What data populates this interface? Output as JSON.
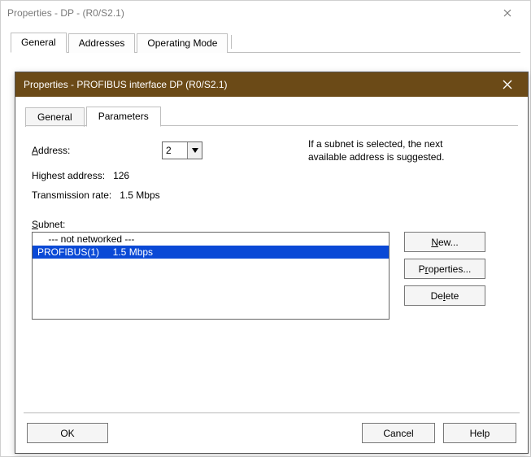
{
  "outer": {
    "title": "Properties - DP - (R0/S2.1)",
    "tabs": [
      "General",
      "Addresses",
      "Operating Mode"
    ]
  },
  "inner": {
    "title": "Properties - PROFIBUS interface  DP (R0/S2.1)",
    "tabs": [
      "General",
      "Parameters"
    ],
    "active_tab": "Parameters",
    "address_label": "Address:",
    "address_value": "2",
    "hint_line1": "If a subnet is selected, the next",
    "hint_line2": "available address is suggested.",
    "highest_label": "Highest address:",
    "highest_value": "126",
    "txrate_label": "Transmission rate:",
    "txrate_value": "1.5 Mbps",
    "subnet_label": "Subnet:",
    "subnet_items": [
      "    --- not networked ---",
      "PROFIBUS(1)     1.5 Mbps"
    ],
    "buttons": {
      "new": "New...",
      "properties": "Properties...",
      "delete": "Delete",
      "ok": "OK",
      "cancel": "Cancel",
      "help": "Help"
    }
  }
}
